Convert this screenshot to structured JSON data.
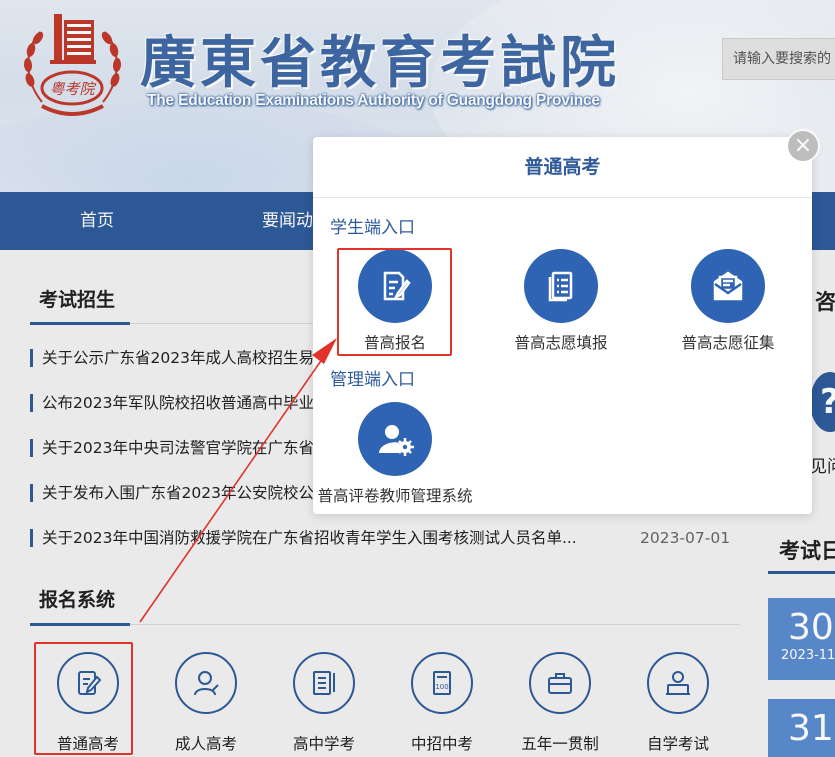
{
  "header": {
    "logo_text": "粤考院",
    "title_cn": "廣東省教育考試院",
    "title_en": "The Education Examinations Authority of Guangdong Province",
    "search_placeholder": "请输入要搜索的"
  },
  "nav": {
    "items": [
      "首页",
      "要闻动"
    ]
  },
  "main": {
    "exam_section_title": "考试招生",
    "news": [
      {
        "title": "关于公示广东省2023年成人高校招生易",
        "date": ""
      },
      {
        "title": "公布2023年军队院校招收普通高中毕业",
        "date": ""
      },
      {
        "title": "关于2023年中央司法警官学院在广东省",
        "date": ""
      },
      {
        "title": "关于发布入围广东省2023年公安院校公",
        "date": ""
      },
      {
        "title": "关于2023年中国消防救援学院在广东省招收青年学生入围考核测试人员名单...",
        "date": "2023-07-01"
      }
    ],
    "system_section_title": "报名系统",
    "systems": [
      {
        "label": "普通高考",
        "icon": "exam-form-icon"
      },
      {
        "label": "成人高考",
        "icon": "adult-user-icon"
      },
      {
        "label": "高中学考",
        "icon": "book-icon"
      },
      {
        "label": "中招中考",
        "icon": "score-sheet-icon"
      },
      {
        "label": "五年一贯制",
        "icon": "briefcase-icon"
      },
      {
        "label": "自学考试",
        "icon": "self-study-icon"
      }
    ]
  },
  "right": {
    "partial_heading_1": "咨",
    "faq_partial": "见问",
    "partial_heading_2": "考试日",
    "dates": [
      {
        "day": "30",
        "ym": "2023-11"
      },
      {
        "day": "31",
        "ym": ""
      }
    ]
  },
  "modal": {
    "title": "普通高考",
    "close_symbol": "×",
    "student_section": "学生端入口",
    "student_entries": [
      {
        "label": "普高报名",
        "icon": "edit-document-icon"
      },
      {
        "label": "普高志愿填报",
        "icon": "list-document-icon"
      },
      {
        "label": "普高志愿征集",
        "icon": "envelope-icon"
      }
    ],
    "admin_section": "管理端入口",
    "admin_entries": [
      {
        "label": "普高评卷教师管理系统",
        "icon": "user-settings-icon"
      }
    ]
  },
  "colors": {
    "brand_blue": "#2f5b9b",
    "icon_blue": "#2f64b4",
    "highlight_red": "#e0342a"
  }
}
